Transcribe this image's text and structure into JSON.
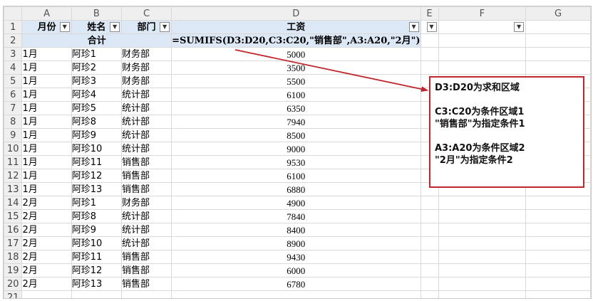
{
  "columns": [
    "A",
    "B",
    "C",
    "D",
    "E",
    "F",
    "G"
  ],
  "rows": [
    "1",
    "2",
    "3",
    "4",
    "5",
    "6",
    "7",
    "8",
    "9",
    "10",
    "11",
    "12",
    "13",
    "14",
    "15",
    "16",
    "17",
    "18",
    "19",
    "20",
    "21"
  ],
  "header": {
    "month": "月份",
    "name": "姓名",
    "dept": "部门",
    "salary": "工资",
    "filter_icon": "chevron-down-icon"
  },
  "total_row": {
    "label": "合计",
    "formula": "=SUMIFS(D3:D20,C3:C20,\"销售部\",A3:A20,\"2月\")"
  },
  "data": [
    {
      "month": "1月",
      "name": "阿珍1",
      "dept": "财务部",
      "salary": "5000"
    },
    {
      "month": "1月",
      "name": "阿珍2",
      "dept": "财务部",
      "salary": "3500"
    },
    {
      "month": "1月",
      "name": "阿珍3",
      "dept": "财务部",
      "salary": "5500"
    },
    {
      "month": "1月",
      "name": "阿珍4",
      "dept": "统计部",
      "salary": "6100"
    },
    {
      "month": "1月",
      "name": "阿珍5",
      "dept": "统计部",
      "salary": "6350"
    },
    {
      "month": "1月",
      "name": "阿珍8",
      "dept": "统计部",
      "salary": "7940"
    },
    {
      "month": "1月",
      "name": "阿珍9",
      "dept": "统计部",
      "salary": "8500"
    },
    {
      "month": "1月",
      "name": "阿珍10",
      "dept": "统计部",
      "salary": "9000"
    },
    {
      "month": "1月",
      "name": "阿珍11",
      "dept": "销售部",
      "salary": "9530"
    },
    {
      "month": "1月",
      "name": "阿珍12",
      "dept": "销售部",
      "salary": "6100"
    },
    {
      "month": "1月",
      "name": "阿珍13",
      "dept": "销售部",
      "salary": "6880"
    },
    {
      "month": "2月",
      "name": "阿珍1",
      "dept": "财务部",
      "salary": "4900"
    },
    {
      "month": "2月",
      "name": "阿珍8",
      "dept": "统计部",
      "salary": "7840"
    },
    {
      "month": "2月",
      "name": "阿珍9",
      "dept": "统计部",
      "salary": "8400"
    },
    {
      "month": "2月",
      "name": "阿珍10",
      "dept": "统计部",
      "salary": "8900"
    },
    {
      "month": "2月",
      "name": "阿珍11",
      "dept": "销售部",
      "salary": "9430"
    },
    {
      "month": "2月",
      "name": "阿珍12",
      "dept": "销售部",
      "salary": "6000"
    },
    {
      "month": "2月",
      "name": "阿珍13",
      "dept": "销售部",
      "salary": "6780"
    }
  ],
  "note": {
    "line1": "D3:D20为求和区域",
    "line2": "C3:C20为条件区域1",
    "line3": "\"销售部\"为指定条件1",
    "line4": "A3:A20为条件区域2",
    "line5": "\"2月\"为指定条件2"
  },
  "colors": {
    "header_fill": "#dde8f7",
    "note_border": "#c0272d",
    "arrow": "#c0272d"
  }
}
